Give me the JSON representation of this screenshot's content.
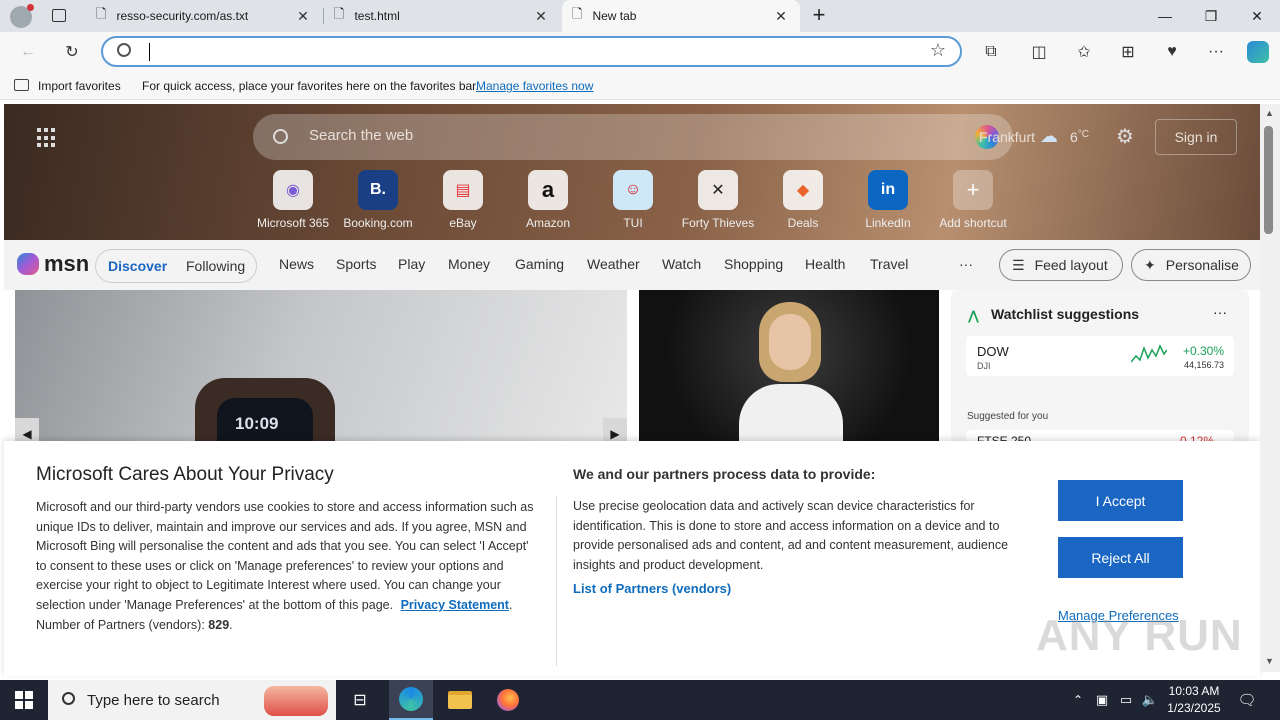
{
  "browser": {
    "tabs": [
      {
        "title": "resso-security.com/as.txt",
        "icon": "page-icon"
      },
      {
        "title": "test.html",
        "icon": "page-icon"
      },
      {
        "title": "New tab",
        "icon": "page-icon",
        "active": true
      }
    ],
    "new_tab_symbol": "+",
    "address_value": "",
    "favorites_bar": {
      "import_label": "Import favorites",
      "message": "For quick access, place your favorites here on the favorites bar.",
      "manage_link": "Manage favorites now"
    }
  },
  "newtab": {
    "search_placeholder": "Search the web",
    "weather_city": "Frankfurt",
    "weather_temp": "6",
    "weather_unit": "°C",
    "sign_in": "Sign in",
    "shortcuts": [
      {
        "label": "Microsoft 365",
        "glyph": "◉"
      },
      {
        "label": "Booking.com",
        "glyph": "B."
      },
      {
        "label": "eBay",
        "glyph": "▤"
      },
      {
        "label": "Amazon",
        "glyph": "a"
      },
      {
        "label": "TUI",
        "glyph": "☺"
      },
      {
        "label": "Forty Thieves",
        "glyph": "✕"
      },
      {
        "label": "Deals",
        "glyph": "◆"
      },
      {
        "label": "LinkedIn",
        "glyph": "in"
      },
      {
        "label": "Add shortcut",
        "glyph": "+"
      }
    ],
    "msn_logo": "msn",
    "nav": {
      "discover": "Discover",
      "following": "Following",
      "links": [
        "News",
        "Sports",
        "Play",
        "Money",
        "Gaming",
        "Weather",
        "Watch",
        "Shopping",
        "Health",
        "Travel"
      ],
      "more": "···",
      "feed_layout": "Feed layout",
      "personalise": "Personalise"
    },
    "watchlist": {
      "title": "Watchlist suggestions",
      "more": "···",
      "dow_name": "DOW",
      "dow_sub": "DJI",
      "dow_change": "+0.30%",
      "dow_value": "44,156.73",
      "suggested": "Suggested for you",
      "ftse_name": "FTSE 250",
      "ftse_change": "0.12%"
    },
    "card_clock": "10:09"
  },
  "privacy": {
    "title": "Microsoft Cares About Your Privacy",
    "body": "Microsoft and our third-party vendors use cookies to store and access information such as unique IDs to deliver, maintain and improve our services and ads. If you agree, MSN and Microsoft Bing will personalise the content and ads that you see. You can select 'I Accept' to consent to these uses or click on 'Manage preferences' to review your options and exercise your right to object to Legitimate Interest where used.  You can change your selection under 'Manage Preferences' at the bottom of this page.",
    "privacy_link": "Privacy Statement",
    "partners_label": "Number of Partners (vendors):",
    "partners_count": "829",
    "right_title": "We and our partners process data to provide:",
    "right_body": "Use precise geolocation data and actively scan device characteristics for identification. This is done to store and access information on a device and to provide personalised ads and content, ad and content measurement, audience insights and product development.",
    "vendors_link": "List of Partners (vendors)",
    "accept": "I Accept",
    "reject": "Reject All",
    "manage": "Manage Preferences"
  },
  "taskbar": {
    "search_placeholder": "Type here to search",
    "time": "10:03 AM",
    "date": "1/23/2025"
  },
  "watermark": "ANY RUN",
  "colors": {
    "accent": "#1a66c2",
    "link": "#0f6cbd",
    "taskbar": "#1f2433"
  }
}
